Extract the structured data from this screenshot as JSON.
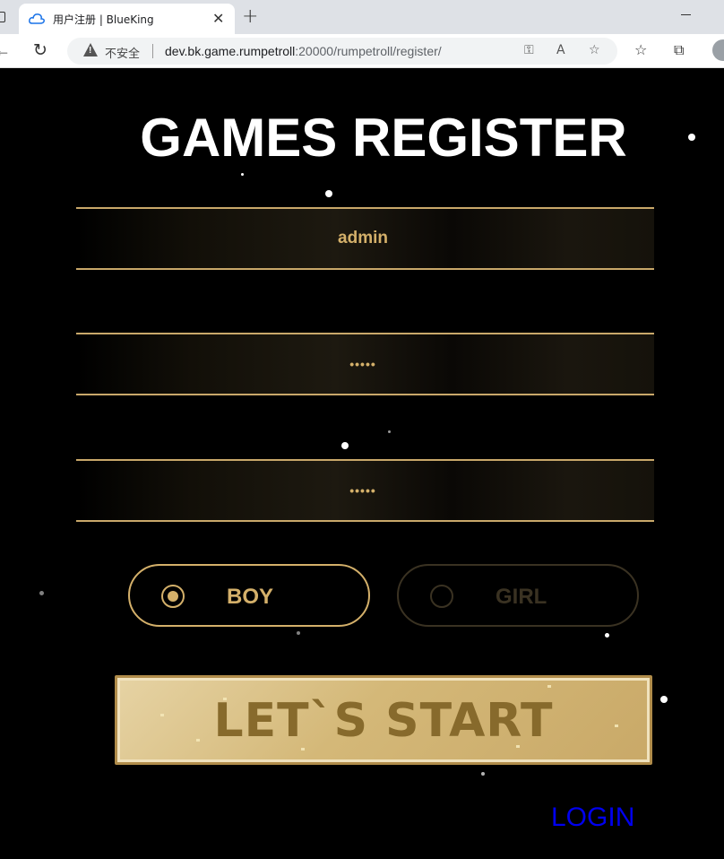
{
  "browser": {
    "tab_title": "用户注册 | BlueKing",
    "tab_close": "✕",
    "new_tab": "+",
    "security_label": "不安全",
    "url_host": "dev.bk.game.rumpetroll",
    "url_rest": ":20000/rumpetroll/register/"
  },
  "page": {
    "heading": "GAMES REGISTER",
    "username_value": "admin",
    "password_value": "•••••",
    "confirm_value": "•••••",
    "gender_boy": "BOY",
    "gender_girl": "GIRL",
    "start_label": "LET`S START",
    "login_label": "LOGIN"
  },
  "colors": {
    "accent_gold": "#d4b06a",
    "background": "#000000",
    "link": "#0000ee"
  }
}
